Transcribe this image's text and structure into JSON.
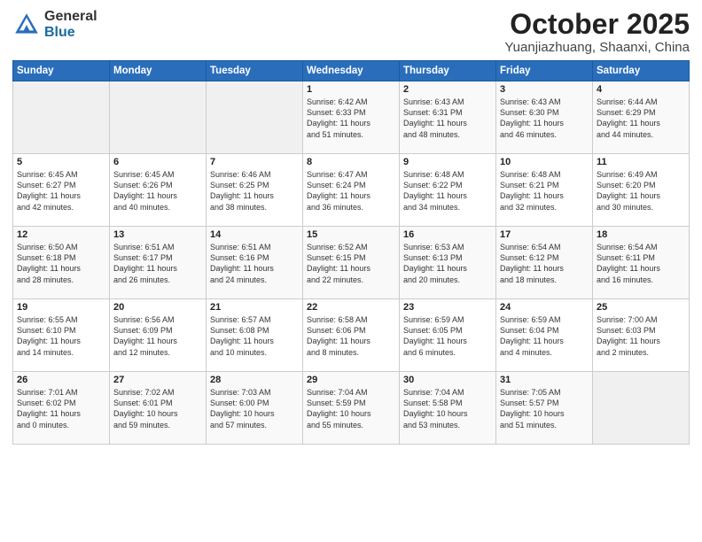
{
  "header": {
    "logo_general": "General",
    "logo_blue": "Blue",
    "month": "October 2025",
    "location": "Yuanjiazhuang, Shaanxi, China"
  },
  "days_of_week": [
    "Sunday",
    "Monday",
    "Tuesday",
    "Wednesday",
    "Thursday",
    "Friday",
    "Saturday"
  ],
  "weeks": [
    [
      {
        "day": "",
        "info": ""
      },
      {
        "day": "",
        "info": ""
      },
      {
        "day": "",
        "info": ""
      },
      {
        "day": "1",
        "info": "Sunrise: 6:42 AM\nSunset: 6:33 PM\nDaylight: 11 hours\nand 51 minutes."
      },
      {
        "day": "2",
        "info": "Sunrise: 6:43 AM\nSunset: 6:31 PM\nDaylight: 11 hours\nand 48 minutes."
      },
      {
        "day": "3",
        "info": "Sunrise: 6:43 AM\nSunset: 6:30 PM\nDaylight: 11 hours\nand 46 minutes."
      },
      {
        "day": "4",
        "info": "Sunrise: 6:44 AM\nSunset: 6:29 PM\nDaylight: 11 hours\nand 44 minutes."
      }
    ],
    [
      {
        "day": "5",
        "info": "Sunrise: 6:45 AM\nSunset: 6:27 PM\nDaylight: 11 hours\nand 42 minutes."
      },
      {
        "day": "6",
        "info": "Sunrise: 6:45 AM\nSunset: 6:26 PM\nDaylight: 11 hours\nand 40 minutes."
      },
      {
        "day": "7",
        "info": "Sunrise: 6:46 AM\nSunset: 6:25 PM\nDaylight: 11 hours\nand 38 minutes."
      },
      {
        "day": "8",
        "info": "Sunrise: 6:47 AM\nSunset: 6:24 PM\nDaylight: 11 hours\nand 36 minutes."
      },
      {
        "day": "9",
        "info": "Sunrise: 6:48 AM\nSunset: 6:22 PM\nDaylight: 11 hours\nand 34 minutes."
      },
      {
        "day": "10",
        "info": "Sunrise: 6:48 AM\nSunset: 6:21 PM\nDaylight: 11 hours\nand 32 minutes."
      },
      {
        "day": "11",
        "info": "Sunrise: 6:49 AM\nSunset: 6:20 PM\nDaylight: 11 hours\nand 30 minutes."
      }
    ],
    [
      {
        "day": "12",
        "info": "Sunrise: 6:50 AM\nSunset: 6:18 PM\nDaylight: 11 hours\nand 28 minutes."
      },
      {
        "day": "13",
        "info": "Sunrise: 6:51 AM\nSunset: 6:17 PM\nDaylight: 11 hours\nand 26 minutes."
      },
      {
        "day": "14",
        "info": "Sunrise: 6:51 AM\nSunset: 6:16 PM\nDaylight: 11 hours\nand 24 minutes."
      },
      {
        "day": "15",
        "info": "Sunrise: 6:52 AM\nSunset: 6:15 PM\nDaylight: 11 hours\nand 22 minutes."
      },
      {
        "day": "16",
        "info": "Sunrise: 6:53 AM\nSunset: 6:13 PM\nDaylight: 11 hours\nand 20 minutes."
      },
      {
        "day": "17",
        "info": "Sunrise: 6:54 AM\nSunset: 6:12 PM\nDaylight: 11 hours\nand 18 minutes."
      },
      {
        "day": "18",
        "info": "Sunrise: 6:54 AM\nSunset: 6:11 PM\nDaylight: 11 hours\nand 16 minutes."
      }
    ],
    [
      {
        "day": "19",
        "info": "Sunrise: 6:55 AM\nSunset: 6:10 PM\nDaylight: 11 hours\nand 14 minutes."
      },
      {
        "day": "20",
        "info": "Sunrise: 6:56 AM\nSunset: 6:09 PM\nDaylight: 11 hours\nand 12 minutes."
      },
      {
        "day": "21",
        "info": "Sunrise: 6:57 AM\nSunset: 6:08 PM\nDaylight: 11 hours\nand 10 minutes."
      },
      {
        "day": "22",
        "info": "Sunrise: 6:58 AM\nSunset: 6:06 PM\nDaylight: 11 hours\nand 8 minutes."
      },
      {
        "day": "23",
        "info": "Sunrise: 6:59 AM\nSunset: 6:05 PM\nDaylight: 11 hours\nand 6 minutes."
      },
      {
        "day": "24",
        "info": "Sunrise: 6:59 AM\nSunset: 6:04 PM\nDaylight: 11 hours\nand 4 minutes."
      },
      {
        "day": "25",
        "info": "Sunrise: 7:00 AM\nSunset: 6:03 PM\nDaylight: 11 hours\nand 2 minutes."
      }
    ],
    [
      {
        "day": "26",
        "info": "Sunrise: 7:01 AM\nSunset: 6:02 PM\nDaylight: 11 hours\nand 0 minutes."
      },
      {
        "day": "27",
        "info": "Sunrise: 7:02 AM\nSunset: 6:01 PM\nDaylight: 10 hours\nand 59 minutes."
      },
      {
        "day": "28",
        "info": "Sunrise: 7:03 AM\nSunset: 6:00 PM\nDaylight: 10 hours\nand 57 minutes."
      },
      {
        "day": "29",
        "info": "Sunrise: 7:04 AM\nSunset: 5:59 PM\nDaylight: 10 hours\nand 55 minutes."
      },
      {
        "day": "30",
        "info": "Sunrise: 7:04 AM\nSunset: 5:58 PM\nDaylight: 10 hours\nand 53 minutes."
      },
      {
        "day": "31",
        "info": "Sunrise: 7:05 AM\nSunset: 5:57 PM\nDaylight: 10 hours\nand 51 minutes."
      },
      {
        "day": "",
        "info": ""
      }
    ]
  ]
}
